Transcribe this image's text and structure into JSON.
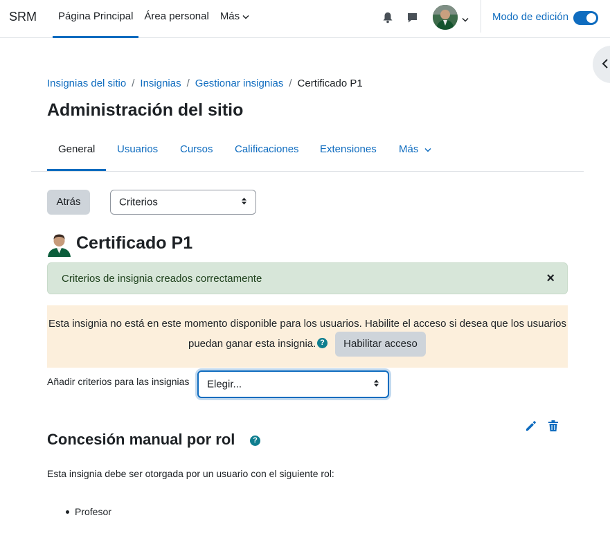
{
  "navbar": {
    "brand": "SRM",
    "items": [
      {
        "label": "Página Principal"
      },
      {
        "label": "Área personal"
      },
      {
        "label": "Más"
      }
    ],
    "edit_mode_label": "Modo de edición"
  },
  "breadcrumb": {
    "items": [
      "Insignias del sitio",
      "Insignias",
      "Gestionar insignias"
    ],
    "current": "Certificado P1"
  },
  "page_title": "Administración del sitio",
  "secondary_nav": {
    "items": [
      {
        "label": "General"
      },
      {
        "label": "Usuarios"
      },
      {
        "label": "Cursos"
      },
      {
        "label": "Calificaciones"
      },
      {
        "label": "Extensiones"
      },
      {
        "label": "Más"
      }
    ]
  },
  "actions": {
    "back_label": "Atrás",
    "select_value": "Criterios"
  },
  "badge": {
    "title": "Certificado P1"
  },
  "alerts": {
    "success": "Criterios de insignia creados correctamente",
    "close_symbol": "×",
    "warning_line1": "Esta insignia no está en este momento disponible para los usuarios. Habilite el acceso si desea que los usuarios",
    "warning_line2": "puedan ganar esta insignia.",
    "enable_label": "Habilitar acceso",
    "help_symbol": "?"
  },
  "criteria": {
    "add_label": "Añadir criterios para las insignias",
    "select_value": "Elegir..."
  },
  "section": {
    "title": "Concesión manual por rol",
    "description": "Esta insignia debe ser otorgada por un usuario con el siguiente rol:",
    "roles": [
      "Profesor"
    ]
  },
  "colors": {
    "primary": "#0f6cbf",
    "success_bg": "#d7e6d9",
    "warning_bg": "#fcefdc",
    "help_icon": "#0f7e8f"
  }
}
